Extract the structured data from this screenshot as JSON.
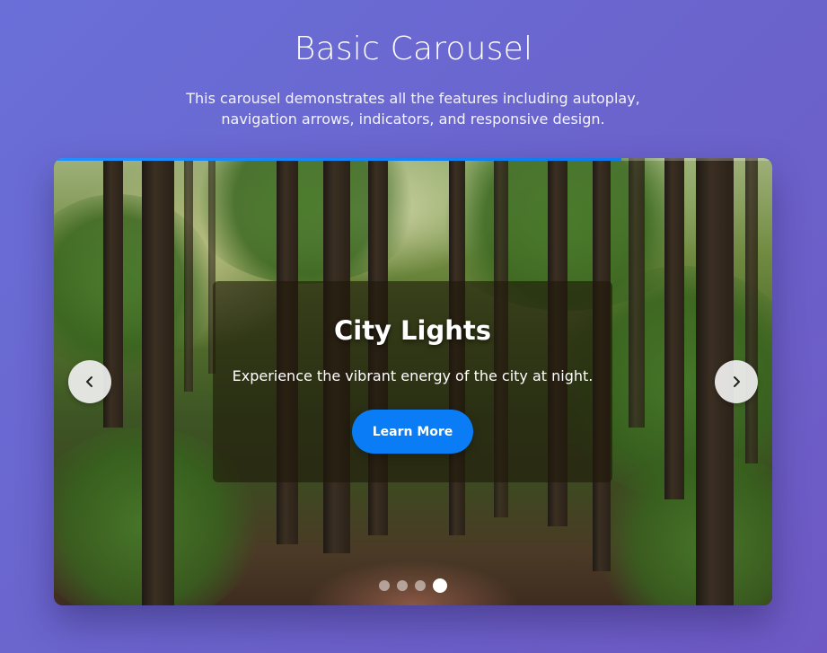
{
  "page": {
    "title": "Basic Carousel",
    "description": "This carousel demonstrates all the features including autoplay, navigation arrows, indicators, and responsive design."
  },
  "carousel": {
    "progress_percent": 79,
    "active_index": 3,
    "slide_count": 4,
    "slide": {
      "title": "City Lights",
      "text": "Experience the vibrant energy of the city at night.",
      "button_label": "Learn More"
    },
    "icons": {
      "prev": "chevron-left-icon",
      "next": "chevron-right-icon"
    }
  },
  "colors": {
    "accent": "#0a7cf5",
    "background_start": "#6a6fd8",
    "background_end": "#6e59c4"
  }
}
